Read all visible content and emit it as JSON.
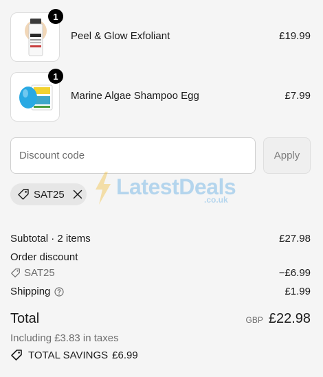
{
  "items": [
    {
      "name": "Peel & Glow Exfoliant",
      "price": "£19.99",
      "quantity": "1"
    },
    {
      "name": "Marine Algae Shampoo Egg",
      "price": "£7.99",
      "quantity": "1"
    }
  ],
  "discount": {
    "placeholder": "Discount code",
    "apply_label": "Apply",
    "applied_code": "SAT25"
  },
  "watermark": {
    "text": "LatestDeals",
    "sub": ".co.uk"
  },
  "summary": {
    "subtotal_label": "Subtotal · 2 items",
    "subtotal_value": "£27.98",
    "order_discount_label": "Order discount",
    "discount_code": "SAT25",
    "discount_value": "−£6.99",
    "shipping_label": "Shipping",
    "shipping_value": "£1.99",
    "total_label": "Total",
    "currency": "GBP",
    "total_value": "£22.98",
    "tax_note": "Including £3.83 in taxes",
    "savings_label": "TOTAL SAVINGS",
    "savings_value": "£6.99"
  },
  "colors": {
    "accent": "#000000",
    "muted": "#6e6e6e",
    "chip_bg": "#e6e6e6",
    "watermark": "#3e9be0"
  },
  "icons": [
    "tag-icon",
    "close-icon",
    "help-circle-icon",
    "bolt-icon"
  ]
}
